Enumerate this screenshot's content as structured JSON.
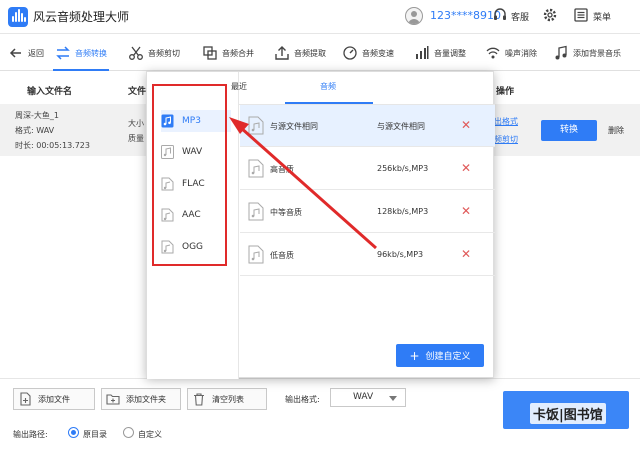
{
  "app": {
    "title": "风云音频处理大师",
    "phone": "123****8910",
    "customer_service": "客服",
    "menu": "菜单"
  },
  "toolbar": {
    "items": [
      {
        "label": "返回",
        "icon": "back-arrow-icon"
      },
      {
        "label": "音频转换",
        "icon": "convert-icon",
        "active": true
      },
      {
        "label": "音频剪切",
        "icon": "scissors-icon"
      },
      {
        "label": "音频合并",
        "icon": "merge-icon"
      },
      {
        "label": "音频提取",
        "icon": "extract-icon"
      },
      {
        "label": "音频变速",
        "icon": "speed-icon"
      },
      {
        "label": "音量调整",
        "icon": "volume-icon"
      },
      {
        "label": "噪声消除",
        "icon": "noise-icon"
      },
      {
        "label": "添加背景音乐",
        "icon": "music-note-icon"
      }
    ]
  },
  "table": {
    "headers": {
      "input_name": "输入文件名",
      "file_info": "文件",
      "operation": "操作"
    },
    "row": {
      "name": "周深-大鱼_1",
      "format": "格式:  WAV",
      "duration": "时长:  00:05:13.723",
      "size_partial": "大小",
      "quality_partial": "质量",
      "output_format_link": "出格式",
      "cut_link": "频剪切",
      "convert": "转换",
      "delete": "删除"
    }
  },
  "popup": {
    "tabs": {
      "recent": "最近",
      "audio": "音频"
    },
    "formats": [
      {
        "label": "MP3",
        "selected": true
      },
      {
        "label": "WAV"
      },
      {
        "label": "FLAC"
      },
      {
        "label": "AAC"
      },
      {
        "label": "OGG"
      }
    ],
    "qualities": [
      {
        "name": "与源文件相同",
        "spec": "与源文件相同",
        "selected": true
      },
      {
        "name": "高音质",
        "spec": "256kb/s,MP3"
      },
      {
        "name": "中等音质",
        "spec": "128kb/s,MP3"
      },
      {
        "name": "低音质",
        "spec": "96kb/s,MP3"
      }
    ],
    "delete_glyph": "✕",
    "custom_button": "创建自定义"
  },
  "bottom": {
    "add_file": "添加文件",
    "add_folder": "添加文件夹",
    "clear_list": "清空列表",
    "output_format_label": "输出格式:",
    "output_format_value": "WAV",
    "output_path_label": "输出路径:",
    "radio_original": "原目录",
    "radio_custom": "自定义"
  },
  "watermark": "卡饭|图书馆",
  "colors": {
    "accent": "#2f7cf6",
    "highlight": "#e02a2a",
    "selected_bg": "#e7f1ff"
  }
}
